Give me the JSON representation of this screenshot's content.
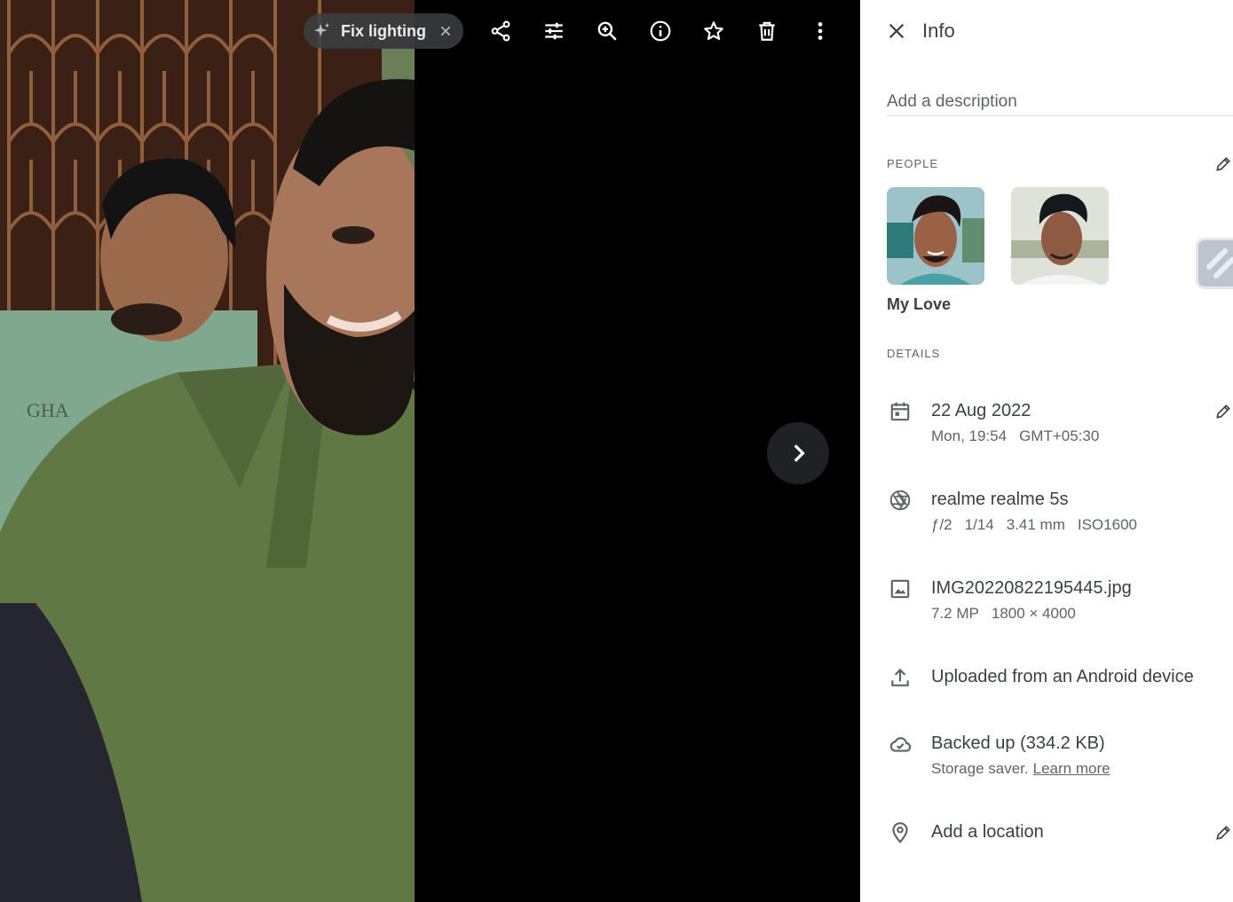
{
  "toolbar": {
    "chip_label": "Fix lighting",
    "buttons": [
      "share-icon",
      "edit-adjust-icon",
      "zoom-in-icon",
      "info-icon",
      "star-icon",
      "delete-icon",
      "more-vert-icon"
    ]
  },
  "panel": {
    "title": "Info",
    "description_placeholder": "Add a description",
    "people_label": "PEOPLE",
    "people": [
      {
        "name": "My Love"
      },
      {
        "name": ""
      }
    ],
    "details_label": "DETAILS",
    "date": {
      "primary": "22 Aug 2022",
      "day_time": "Mon, 19:54",
      "timezone": "GMT+05:30"
    },
    "camera": {
      "primary": "realme realme 5s",
      "aperture": "ƒ/2",
      "shutter": "1/14",
      "focal": "3.41 mm",
      "iso": "ISO1600"
    },
    "file": {
      "primary": "IMG20220822195445.jpg",
      "megapixels": "7.2 MP",
      "dimensions": "1800 × 4000"
    },
    "upload": {
      "primary": "Uploaded from an Android device"
    },
    "backup": {
      "primary": "Backed up (334.2 KB)",
      "saver": "Storage saver.",
      "learn_more": "Learn more"
    },
    "location": {
      "primary": "Add a location"
    }
  },
  "colors": {
    "link": "#1a73e8",
    "text": "#3c4043",
    "muted": "#5f6368",
    "viewer_bg": "#000000"
  }
}
